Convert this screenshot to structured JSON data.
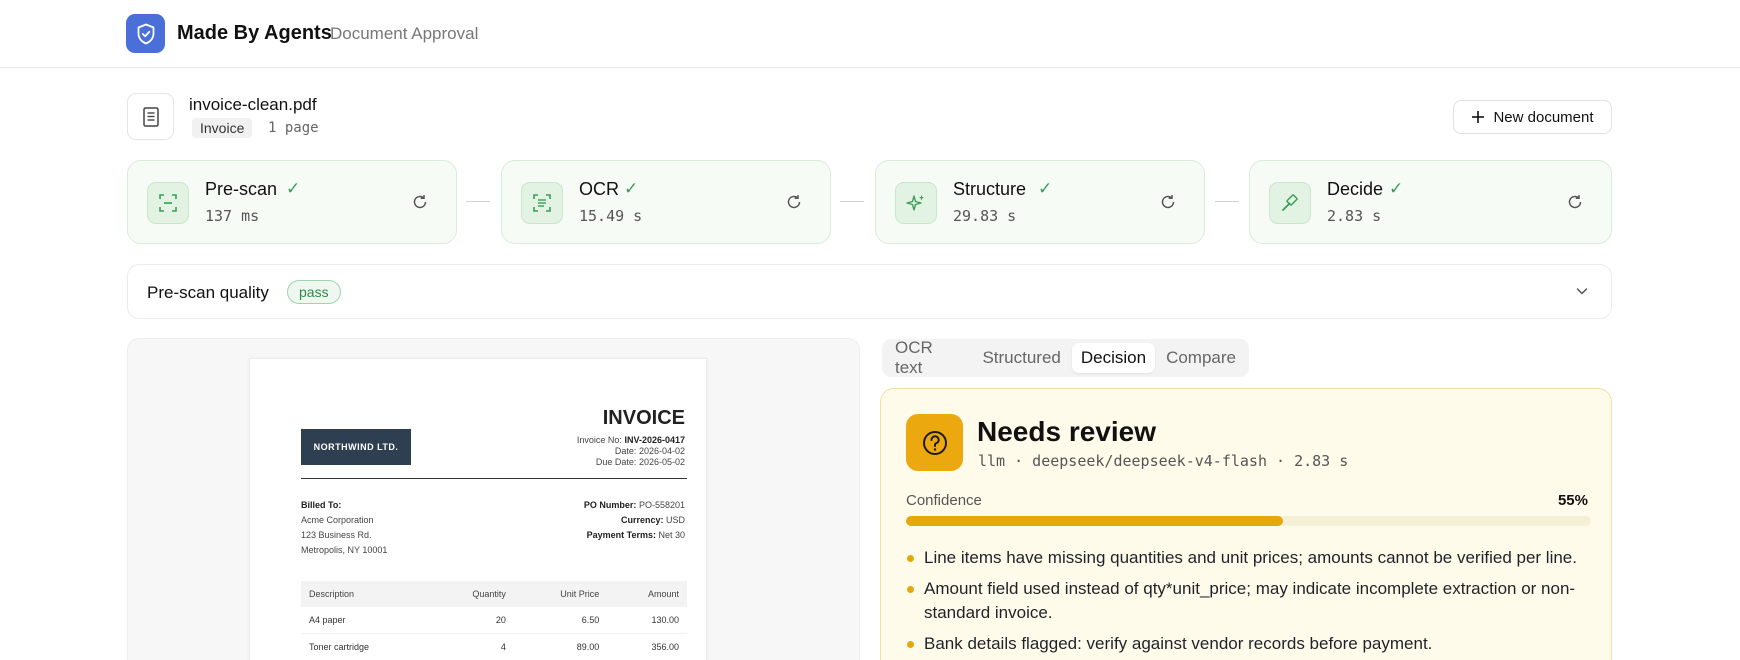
{
  "header": {
    "app_name": "Made By Agents",
    "app_subtitle": "Document Approval"
  },
  "document": {
    "filename": "invoice-clean.pdf",
    "type_badge": "Invoice",
    "pages": "1 page",
    "new_document_label": "New document"
  },
  "pipeline": {
    "steps": [
      {
        "title": "Pre-scan",
        "time": "137 ms",
        "status": "done"
      },
      {
        "title": "OCR",
        "time": "15.49 s",
        "status": "done"
      },
      {
        "title": "Structure",
        "time": "29.83 s",
        "status": "done"
      },
      {
        "title": "Decide",
        "time": "2.83 s",
        "status": "done"
      }
    ]
  },
  "quality": {
    "label": "Pre-scan quality",
    "badge": "pass"
  },
  "invoice_preview": {
    "company": "NORTHWIND LTD.",
    "title": "INVOICE",
    "invoice_no_label": "Invoice No:",
    "invoice_no": "INV-2026-0417",
    "date_label": "Date:",
    "date": "2026-04-02",
    "due_label": "Due Date:",
    "due": "2026-05-02",
    "billed_to_label": "Billed To:",
    "billed_name": "Acme Corporation",
    "billed_street": "123 Business Rd.",
    "billed_city": "Metropolis, NY 10001",
    "po_label": "PO Number:",
    "po": "PO-558201",
    "currency_label": "Currency:",
    "currency": "USD",
    "terms_label": "Payment Terms:",
    "terms": "Net 30",
    "columns": [
      "Description",
      "Quantity",
      "Unit Price",
      "Amount"
    ],
    "rows": [
      {
        "description": "A4 paper",
        "quantity": "20",
        "unit_price": "6.50",
        "amount": "130.00"
      },
      {
        "description": "Toner cartridge",
        "quantity": "4",
        "unit_price": "89.00",
        "amount": "356.00"
      }
    ]
  },
  "tabs": {
    "items": [
      "OCR text",
      "Structured",
      "Decision",
      "Compare"
    ],
    "active": "Decision"
  },
  "decision": {
    "title": "Needs review",
    "meta": "llm · deepseek/deepseek-v4-flash · 2.83 s",
    "confidence_label": "Confidence",
    "confidence_value": "55%",
    "confidence_fraction": 0.55,
    "reasons": [
      "Line items have missing quantities and unit prices; amounts cannot be verified per line.",
      "Amount field used instead of qty*unit_price; may indicate incomplete extraction or non-standard invoice.",
      "Bank details flagged: verify against vendor records before payment."
    ]
  },
  "colors": {
    "brand": "#4a6fd8",
    "success": "#3a9d56",
    "warning": "#e6a70b"
  }
}
